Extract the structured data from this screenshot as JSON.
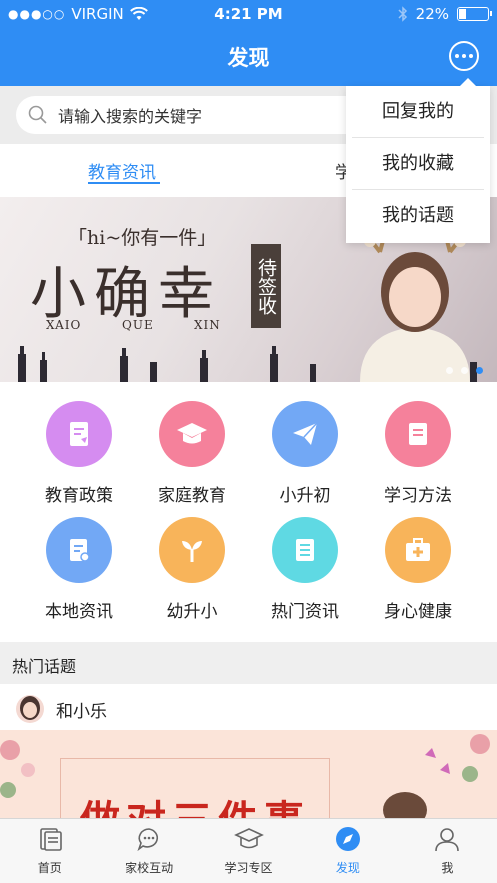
{
  "status_bar": {
    "carrier": "VIRGIN",
    "time": "4:21 PM",
    "battery": "22%",
    "battery_level": 0.22
  },
  "nav": {
    "title": "发现"
  },
  "search": {
    "placeholder": "请输入搜索的关键字"
  },
  "tabs": [
    {
      "label": "教育资讯",
      "active": true
    },
    {
      "label": "学",
      "active": false
    }
  ],
  "banner": {
    "quote": "「hi~你有一件」",
    "headline": "小确幸",
    "pinyin": [
      "XAIO",
      "QUE",
      "XIN"
    ],
    "stamp": "待签收",
    "slide_count": 3,
    "active_slide": 3
  },
  "categories": [
    {
      "label": "教育政策",
      "icon": "document-icon",
      "color": "#d58cf0"
    },
    {
      "label": "家庭教育",
      "icon": "graduation-cap-icon",
      "color": "#f5819b"
    },
    {
      "label": "小升初",
      "icon": "paper-plane-icon",
      "color": "#72a8f5"
    },
    {
      "label": "学习方法",
      "icon": "book-icon",
      "color": "#f5819b"
    },
    {
      "label": "本地资讯",
      "icon": "clipboard-location-icon",
      "color": "#72a8f5"
    },
    {
      "label": "幼升小",
      "icon": "sprout-icon",
      "color": "#f8b45a"
    },
    {
      "label": "热门资讯",
      "icon": "news-icon",
      "color": "#5fd9e3"
    },
    {
      "label": "身心健康",
      "icon": "medical-kit-icon",
      "color": "#f8b45a"
    }
  ],
  "hot_topics": {
    "title": "热门话题",
    "post": {
      "author": "和小乐",
      "image_headline": "做对三件事"
    }
  },
  "popup_menu": {
    "items": [
      "回复我的",
      "我的收藏",
      "我的话题"
    ]
  },
  "tabbar": {
    "items": [
      {
        "label": "首页",
        "icon": "home-doc-icon",
        "active": false
      },
      {
        "label": "家校互动",
        "icon": "chat-bubble-icon",
        "active": false
      },
      {
        "label": "学习专区",
        "icon": "graduation-cap-icon",
        "active": false
      },
      {
        "label": "发现",
        "icon": "compass-icon",
        "active": true
      },
      {
        "label": "我",
        "icon": "person-icon",
        "active": false
      }
    ]
  },
  "colors": {
    "primary": "#2f8df4"
  }
}
